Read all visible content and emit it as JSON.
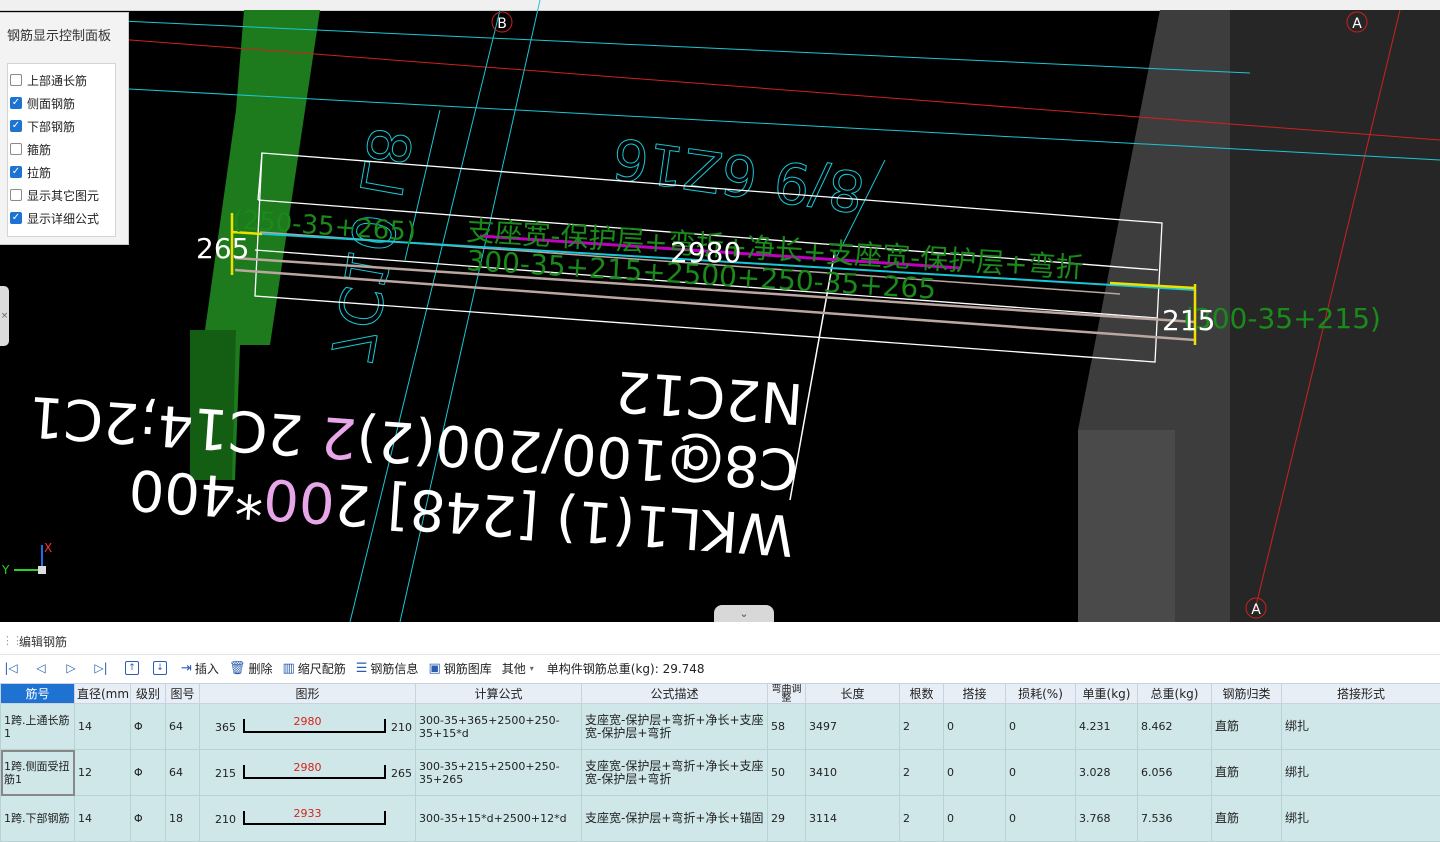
{
  "viewport": {
    "axis_labels": {
      "b_top": "B",
      "a_top": "A",
      "a_bottom": "A"
    },
    "dim_left": "265",
    "dim_center": "2980",
    "dim_right": "215",
    "formula_left": "(250-35+265)",
    "formula_right": "(300-35+215)",
    "formula_desc": "支座宽-保护层+弯折+净长+支座宽-保护层+弯折",
    "formula_numbers": "300-35+215+2500+250-35+265",
    "beam_label_line1": "N2C12",
    "beam_label_line2": "C8@100/200(2)",
    "beam_label_line3a": "WKL1(1) [248] 2",
    "beam_label_line3b": "00",
    "beam_label_line3c": "*400",
    "beam_label_line2_tail": " 2C14;2C1",
    "beam_label_line2_pink": "2",
    "ghost_left": "7C10 L8",
    "ghost_right": "8/9 6Z16",
    "axis_indicator_y": "Y",
    "axis_indicator_x": "X"
  },
  "control_panel": {
    "title": "钢筋显示控制面板",
    "options": [
      {
        "label": "上部通长筋",
        "checked": false
      },
      {
        "label": "侧面钢筋",
        "checked": true
      },
      {
        "label": "下部钢筋",
        "checked": true
      },
      {
        "label": "箍筋",
        "checked": false
      },
      {
        "label": "拉筋",
        "checked": true
      },
      {
        "label": "显示其它图元",
        "checked": false
      },
      {
        "label": "显示详细公式",
        "checked": true
      }
    ]
  },
  "editor": {
    "title": "编辑钢筋",
    "toolbar": {
      "insert": "插入",
      "delete": "删除",
      "scale": "缩尺配筋",
      "info": "钢筋信息",
      "library": "钢筋图库",
      "other": "其他",
      "total_label": "单构件钢筋总重(kg): 29.748"
    },
    "columns": [
      "筋号",
      "直径(mm)",
      "级别",
      "图号",
      "图形",
      "计算公式",
      "公式描述",
      "弯曲调整",
      "长度",
      "根数",
      "搭接",
      "损耗(%)",
      "单重(kg)",
      "总重(kg)",
      "钢筋归类",
      "搭接形式"
    ],
    "rows": [
      {
        "id": "1跨.上通长筋1",
        "dia": "14",
        "grade": "Φ",
        "fig": "64",
        "shape_l": "365",
        "shape_mid": "2980",
        "shape_r": "210",
        "formula": "300-35+365+2500+250-35+15*d",
        "desc": "支座宽-保护层+弯折+净长+支座宽-保护层+弯折",
        "bend": "58",
        "length": "3497",
        "count": "2",
        "lap": "0",
        "loss": "0",
        "unit_w": "4.231",
        "total_w": "8.462",
        "cat": "直筋",
        "lap_type": "绑扎"
      },
      {
        "id": "1跨.侧面受扭筋1",
        "dia": "12",
        "grade": "Φ",
        "fig": "64",
        "shape_l": "215",
        "shape_mid": "2980",
        "shape_r": "265",
        "formula": "300-35+215+2500+250-35+265",
        "desc": "支座宽-保护层+弯折+净长+支座宽-保护层+弯折",
        "bend": "50",
        "length": "3410",
        "count": "2",
        "lap": "0",
        "loss": "0",
        "unit_w": "3.028",
        "total_w": "6.056",
        "cat": "直筋",
        "lap_type": "绑扎"
      },
      {
        "id": "1跨.下部钢筋",
        "dia": "14",
        "grade": "Φ",
        "fig": "18",
        "shape_l": "210",
        "shape_mid": "2933",
        "shape_r": "",
        "formula": "300-35+15*d+2500+12*d",
        "desc": "支座宽-保护层+弯折+净长+锚固",
        "bend": "29",
        "length": "3114",
        "count": "2",
        "lap": "0",
        "loss": "0",
        "unit_w": "3.768",
        "total_w": "7.536",
        "cat": "直筋",
        "lap_type": "绑扎"
      }
    ]
  },
  "colors": {
    "selection_blue": "#1e73d2",
    "row_bg": "#cfe7e9",
    "cad_green": "#1a8a1a",
    "cad_cyan": "#19c7d6",
    "cad_magenta": "#c000c0",
    "cad_yellow": "#f0e000"
  }
}
